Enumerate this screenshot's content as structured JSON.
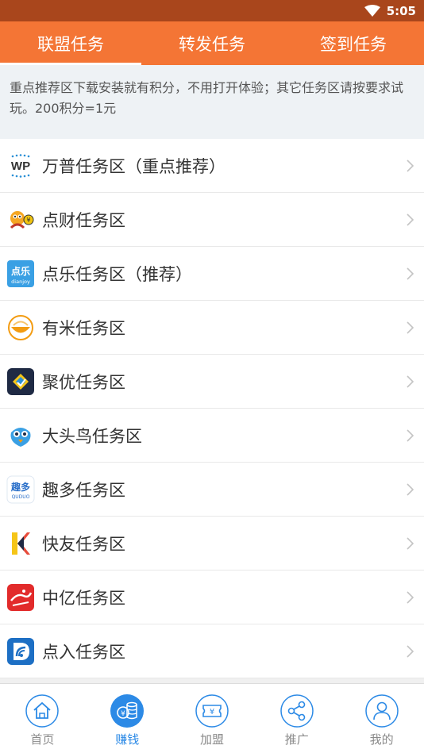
{
  "status": {
    "time": "5:05"
  },
  "tabs": [
    {
      "label": "联盟任务",
      "active": true
    },
    {
      "label": "转发任务",
      "active": false
    },
    {
      "label": "签到任务",
      "active": false
    }
  ],
  "notice": "重点推荐区下载安装就有积分，不用打开体验；其它任务区请按要求试玩。200积分=1元",
  "tasks": [
    {
      "label": "万普任务区（重点推荐）",
      "icon": "wanpu-logo-icon",
      "logo_text": "WP"
    },
    {
      "label": "点财任务区",
      "icon": "diancai-logo-icon"
    },
    {
      "label": "点乐任务区（推荐）",
      "icon": "dianle-logo-icon",
      "logo_text": "点乐",
      "logo_sub": "dianjoy"
    },
    {
      "label": "有米任务区",
      "icon": "youmi-logo-icon"
    },
    {
      "label": "聚优任务区",
      "icon": "juyou-logo-icon"
    },
    {
      "label": "大头鸟任务区",
      "icon": "datouniao-logo-icon"
    },
    {
      "label": "趣多任务区",
      "icon": "quduo-logo-icon",
      "logo_text": "趣多",
      "logo_sub": "QUDUO"
    },
    {
      "label": "快友任务区",
      "icon": "kuaiyou-logo-icon"
    },
    {
      "label": "中亿任务区",
      "icon": "zhongyi-logo-icon"
    },
    {
      "label": "点入任务区",
      "icon": "dianru-logo-icon"
    }
  ],
  "nav": [
    {
      "label": "首页",
      "icon": "home-icon",
      "active": false
    },
    {
      "label": "赚钱",
      "icon": "coins-icon",
      "active": true
    },
    {
      "label": "加盟",
      "icon": "ticket-icon",
      "active": false
    },
    {
      "label": "推广",
      "icon": "share-icon",
      "active": false
    },
    {
      "label": "我的",
      "icon": "user-icon",
      "active": false
    }
  ],
  "colors": {
    "accent": "#f47535",
    "status_bar": "#a9461c",
    "nav_active": "#2c8ae6"
  }
}
